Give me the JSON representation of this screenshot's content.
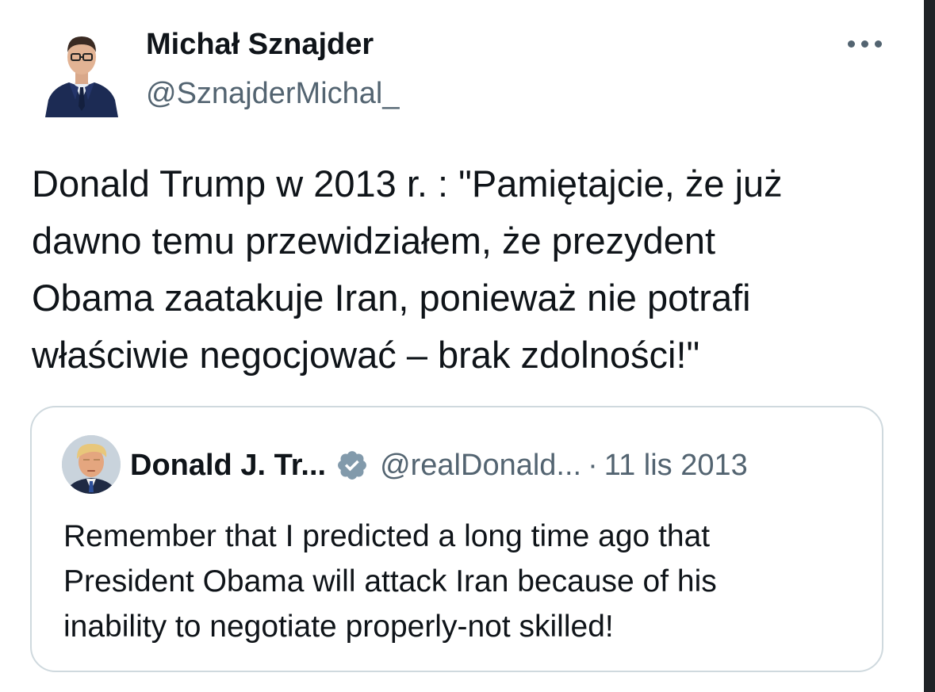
{
  "tweet": {
    "author_name": "Michał Sznajder",
    "author_handle": "@SznajderMichal_",
    "avatar_icon": "person-portrait-icon",
    "more_icon": "more-horizontal-icon",
    "text_lines": [
      "Donald Trump w 2013 r. : \"Pamiętajcie, że już",
      "dawno temu przewidziałem, że prezydent",
      "Obama zaatakuje Iran, ponieważ nie potrafi",
      "właściwie negocjować – brak zdolności!\""
    ]
  },
  "quoted_tweet": {
    "author_name": "Donald J. Tr...",
    "verified_icon": "verified-badge-icon",
    "author_handle": "@realDonald...",
    "separator": "·",
    "date": "11 lis 2013",
    "text_lines": [
      "Remember that I predicted a long time ago that",
      "President Obama will attack Iran because of his",
      "inability to negotiate properly-not skilled!"
    ]
  },
  "colors": {
    "primary_text": "#0f1419",
    "secondary_text": "#536471",
    "border": "#cfd9de",
    "verified_badge": "#829aab"
  }
}
